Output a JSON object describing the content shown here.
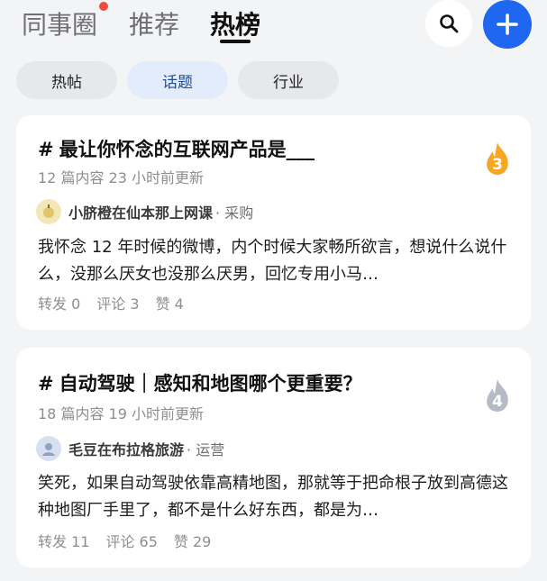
{
  "header": {
    "tabs": [
      {
        "label": "同事圈"
      },
      {
        "label": "推荐"
      },
      {
        "label": "热榜"
      }
    ]
  },
  "subtabs": [
    "热帖",
    "话题",
    "行业"
  ],
  "cards": [
    {
      "title": "最让你怀念的互联网产品是___",
      "meta": "12 篇内容 23 小时前更新",
      "author": "小脐橙在仙本那上网课",
      "dept": "· 采购",
      "excerpt": "我怀念 12 年时候的微博，内个时候大家畅所欲言，想说什么说什么，没那么厌女也没那么厌男，回忆专用小马…",
      "stats": [
        "转发 0",
        "评论 3",
        "赞 4"
      ],
      "rank": "3"
    },
    {
      "title": "自动驾驶｜感知和地图哪个更重要？",
      "meta": "18 篇内容 19 小时前更新",
      "author": "毛豆在布拉格旅游",
      "dept": "· 运营",
      "excerpt": "笑死，如果自动驾驶依靠高精地图，那就等于把命根子放到高德这种地图厂手里了，都不是什么好东西，都是为…",
      "stats": [
        "转发 11",
        "评论 65",
        "赞 29"
      ],
      "rank": "4"
    }
  ],
  "colors": {
    "accent": "#1f66f0",
    "rank_gold": "#f5a623",
    "rank_gray": "#b4bac6"
  },
  "icons": [
    "search-icon",
    "plus-icon",
    "notification-dot",
    "flame-rank-icon"
  ]
}
